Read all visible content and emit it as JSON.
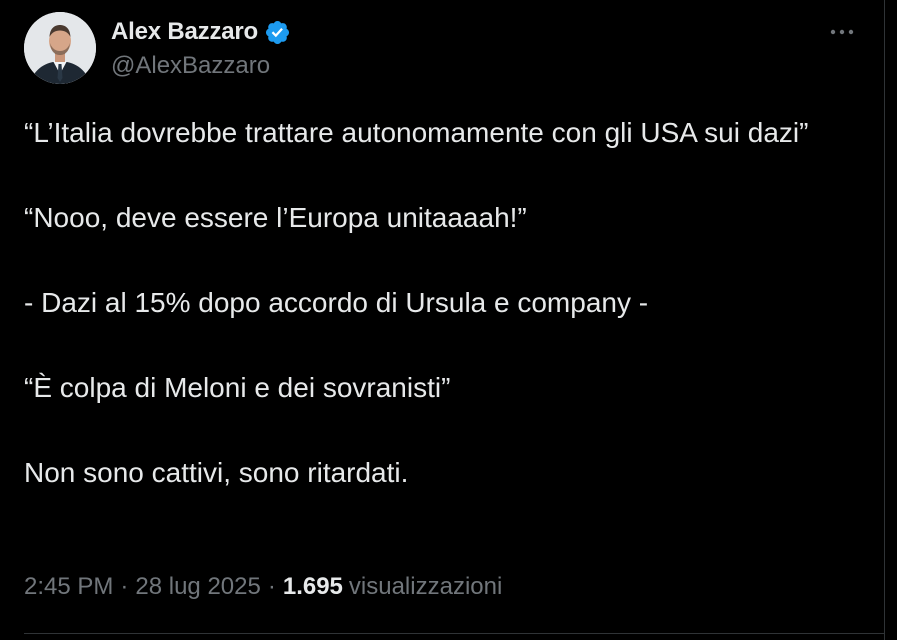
{
  "author": {
    "display_name": "Alex Bazzaro",
    "handle": "@AlexBazzaro",
    "verified": true,
    "verified_color": "#1d9bf0"
  },
  "tweet": {
    "paragraphs": [
      "“L’Italia dovrebbe trattare autonomamente con gli USA sui dazi”",
      "“Nooo, deve essere l’Europa unitaaaah!”",
      "- Dazi al 15% dopo accordo di Ursula e company -",
      "“È colpa di Meloni e dei sovranisti”",
      "Non sono cattivi, sono ritardati."
    ],
    "time": "2:45 PM",
    "date": "28 lug 2025",
    "separator": "·",
    "views_count": "1.695",
    "views_label": "visualizzazioni"
  },
  "icons": {
    "more": "more-horizontal-icon",
    "verified": "verified-badge-icon"
  },
  "colors": {
    "background": "#000000",
    "text_primary": "#e7e9ea",
    "text_secondary": "#71767b",
    "border": "#2f3336",
    "accent": "#1d9bf0"
  }
}
